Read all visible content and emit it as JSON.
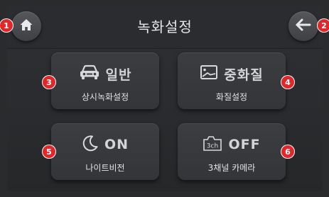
{
  "header": {
    "title": "녹화설정"
  },
  "badges": [
    "1",
    "2",
    "3",
    "4",
    "5",
    "6"
  ],
  "tiles": [
    {
      "main": "일반",
      "sub": "상시녹화설정",
      "icon": "car-icon"
    },
    {
      "main": "중화질",
      "sub": "화질설정",
      "icon": "image-icon"
    },
    {
      "main": "ON",
      "sub": "나이트비전",
      "icon": "moon-icon"
    },
    {
      "main": "OFF",
      "sub": "3채널 카메라",
      "icon": "3ch-camera-icon",
      "icon_text": "3ch"
    }
  ],
  "colors": {
    "background": "#2a2b2d",
    "tile": "#37393c",
    "badge": "#e0282b",
    "text": "#e1e2e3"
  }
}
